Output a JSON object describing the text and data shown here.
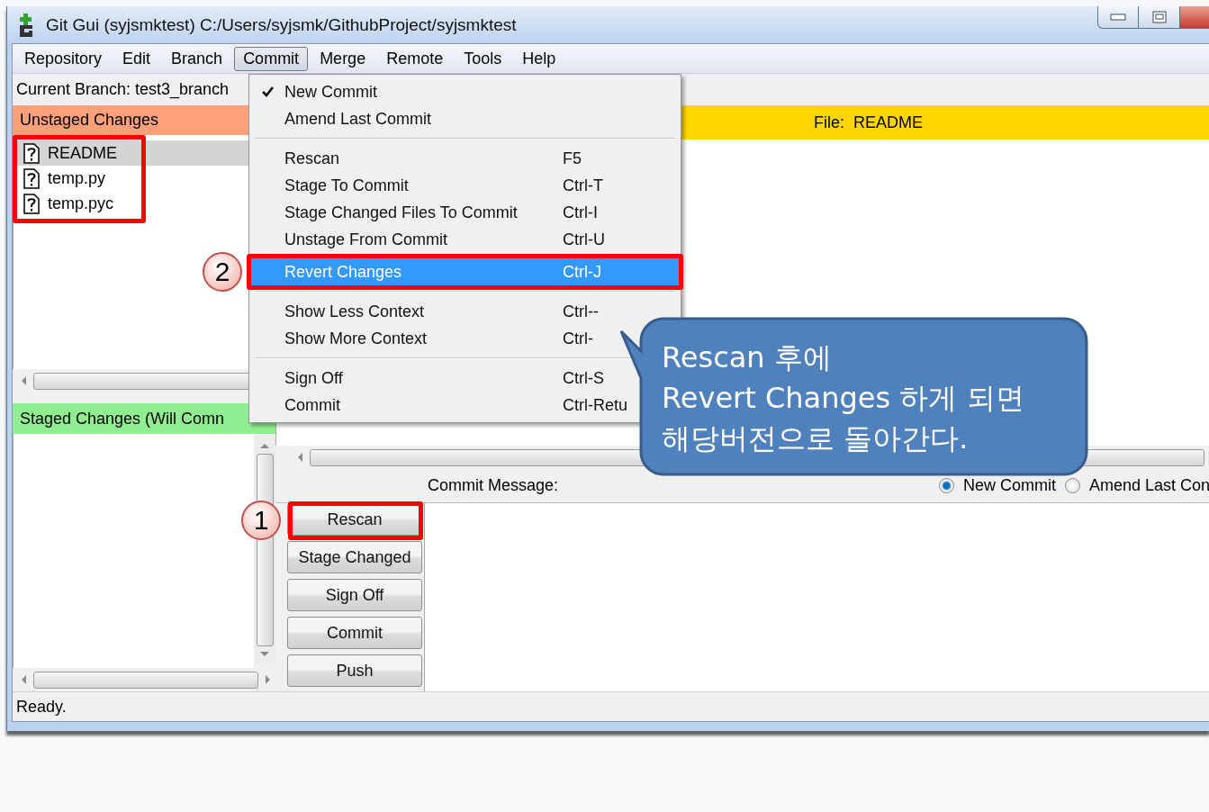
{
  "window": {
    "title": "Git Gui (syjsmktest) C:/Users/syjsmk/GithubProject/syjsmktest"
  },
  "menubar": [
    {
      "label": "Repository",
      "selected": false
    },
    {
      "label": "Edit",
      "selected": false
    },
    {
      "label": "Branch",
      "selected": false
    },
    {
      "label": "Commit",
      "selected": true
    },
    {
      "label": "Merge",
      "selected": false
    },
    {
      "label": "Remote",
      "selected": false
    },
    {
      "label": "Tools",
      "selected": false
    },
    {
      "label": "Help",
      "selected": false
    }
  ],
  "branch_label": "Current Branch: test3_branch",
  "unstaged": {
    "header": "Unstaged Changes",
    "files": [
      {
        "name": "README",
        "selected": true
      },
      {
        "name": "temp.py",
        "selected": false
      },
      {
        "name": "temp.pyc",
        "selected": false
      }
    ]
  },
  "staged": {
    "header": "Staged Changes (Will Comn"
  },
  "diff": {
    "label": "File:",
    "file": "README"
  },
  "commit_message": {
    "label": "Commit Message:",
    "modes": [
      {
        "label": "New Commit",
        "selected": true
      },
      {
        "label": "Amend Last Con",
        "selected": false
      }
    ]
  },
  "buttons": [
    "Rescan",
    "Stage Changed",
    "Sign Off",
    "Commit",
    "Push"
  ],
  "status_bar": "Ready.",
  "commit_menu": {
    "sections": [
      {
        "items": [
          {
            "label": "New Commit",
            "checked": true,
            "selected": false
          },
          {
            "label": "Amend Last Commit",
            "checked": false,
            "selected": false
          }
        ]
      },
      {
        "items": [
          {
            "label": "Rescan",
            "shortcut": "F5",
            "selected": false
          },
          {
            "label": "Stage To Commit",
            "shortcut": "Ctrl-T",
            "selected": false
          },
          {
            "label": "Stage Changed Files To Commit",
            "shortcut": "Ctrl-I",
            "selected": false
          },
          {
            "label": "Unstage From Commit",
            "shortcut": "Ctrl-U",
            "selected": false
          },
          {
            "label": "Revert Changes",
            "shortcut": "Ctrl-J",
            "selected": true
          }
        ]
      },
      {
        "items": [
          {
            "label": "Show Less Context",
            "shortcut": "Ctrl--",
            "selected": false
          },
          {
            "label": "Show More Context",
            "shortcut": "Ctrl-",
            "selected": false
          }
        ]
      },
      {
        "items": [
          {
            "label": "Sign Off",
            "shortcut": "Ctrl-S",
            "selected": false
          },
          {
            "label": "Commit",
            "shortcut": "Ctrl-Retu",
            "selected": false
          }
        ]
      }
    ]
  },
  "annotations": {
    "callout": "Rescan 후에\nRevert Changes 하게 되면\n해당버전으로 돌아간다.",
    "steps": [
      "1",
      "2"
    ]
  }
}
